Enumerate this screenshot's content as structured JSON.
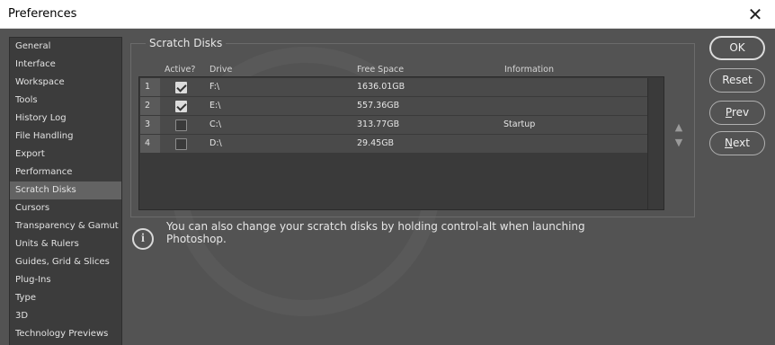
{
  "window": {
    "title": "Preferences",
    "close_glyph": "✕"
  },
  "sidebar": {
    "items": [
      {
        "label": "General"
      },
      {
        "label": "Interface"
      },
      {
        "label": "Workspace"
      },
      {
        "label": "Tools"
      },
      {
        "label": "History Log"
      },
      {
        "label": "File Handling"
      },
      {
        "label": "Export"
      },
      {
        "label": "Performance"
      },
      {
        "label": "Scratch Disks",
        "selected": true
      },
      {
        "label": "Cursors"
      },
      {
        "label": "Transparency & Gamut"
      },
      {
        "label": "Units & Rulers"
      },
      {
        "label": "Guides, Grid & Slices"
      },
      {
        "label": "Plug-Ins"
      },
      {
        "label": "Type"
      },
      {
        "label": "3D"
      },
      {
        "label": "Technology Previews"
      }
    ]
  },
  "scratch_disks": {
    "group_label": "Scratch Disks",
    "columns": {
      "active": "Active?",
      "drive": "Drive",
      "free_space": "Free Space",
      "information": "Information"
    },
    "rows": [
      {
        "num": "1",
        "active": true,
        "drive": "F:\\",
        "free_space": "1636.01GB",
        "information": ""
      },
      {
        "num": "2",
        "active": true,
        "drive": "E:\\",
        "free_space": "557.36GB",
        "information": ""
      },
      {
        "num": "3",
        "active": false,
        "drive": "C:\\",
        "free_space": "313.77GB",
        "information": "Startup"
      },
      {
        "num": "4",
        "active": false,
        "drive": "D:\\",
        "free_space": "29.45GB",
        "information": ""
      }
    ],
    "move_up_glyph": "▲",
    "move_down_glyph": "▼"
  },
  "info": {
    "icon": "info-icon",
    "icon_glyph": "i",
    "text": "You can also change your scratch disks by holding control-alt when launching Photoshop."
  },
  "buttons": {
    "ok": "OK",
    "reset": "Reset",
    "prev_mnemonic": "P",
    "prev_rest": "rev",
    "next_mnemonic": "N",
    "next_rest": "ext"
  },
  "colors": {
    "panel_bg": "#535353",
    "sidebar_bg": "#3c3c3c",
    "selected_bg": "#636363",
    "table_row_bg": "#4a4a4a"
  }
}
